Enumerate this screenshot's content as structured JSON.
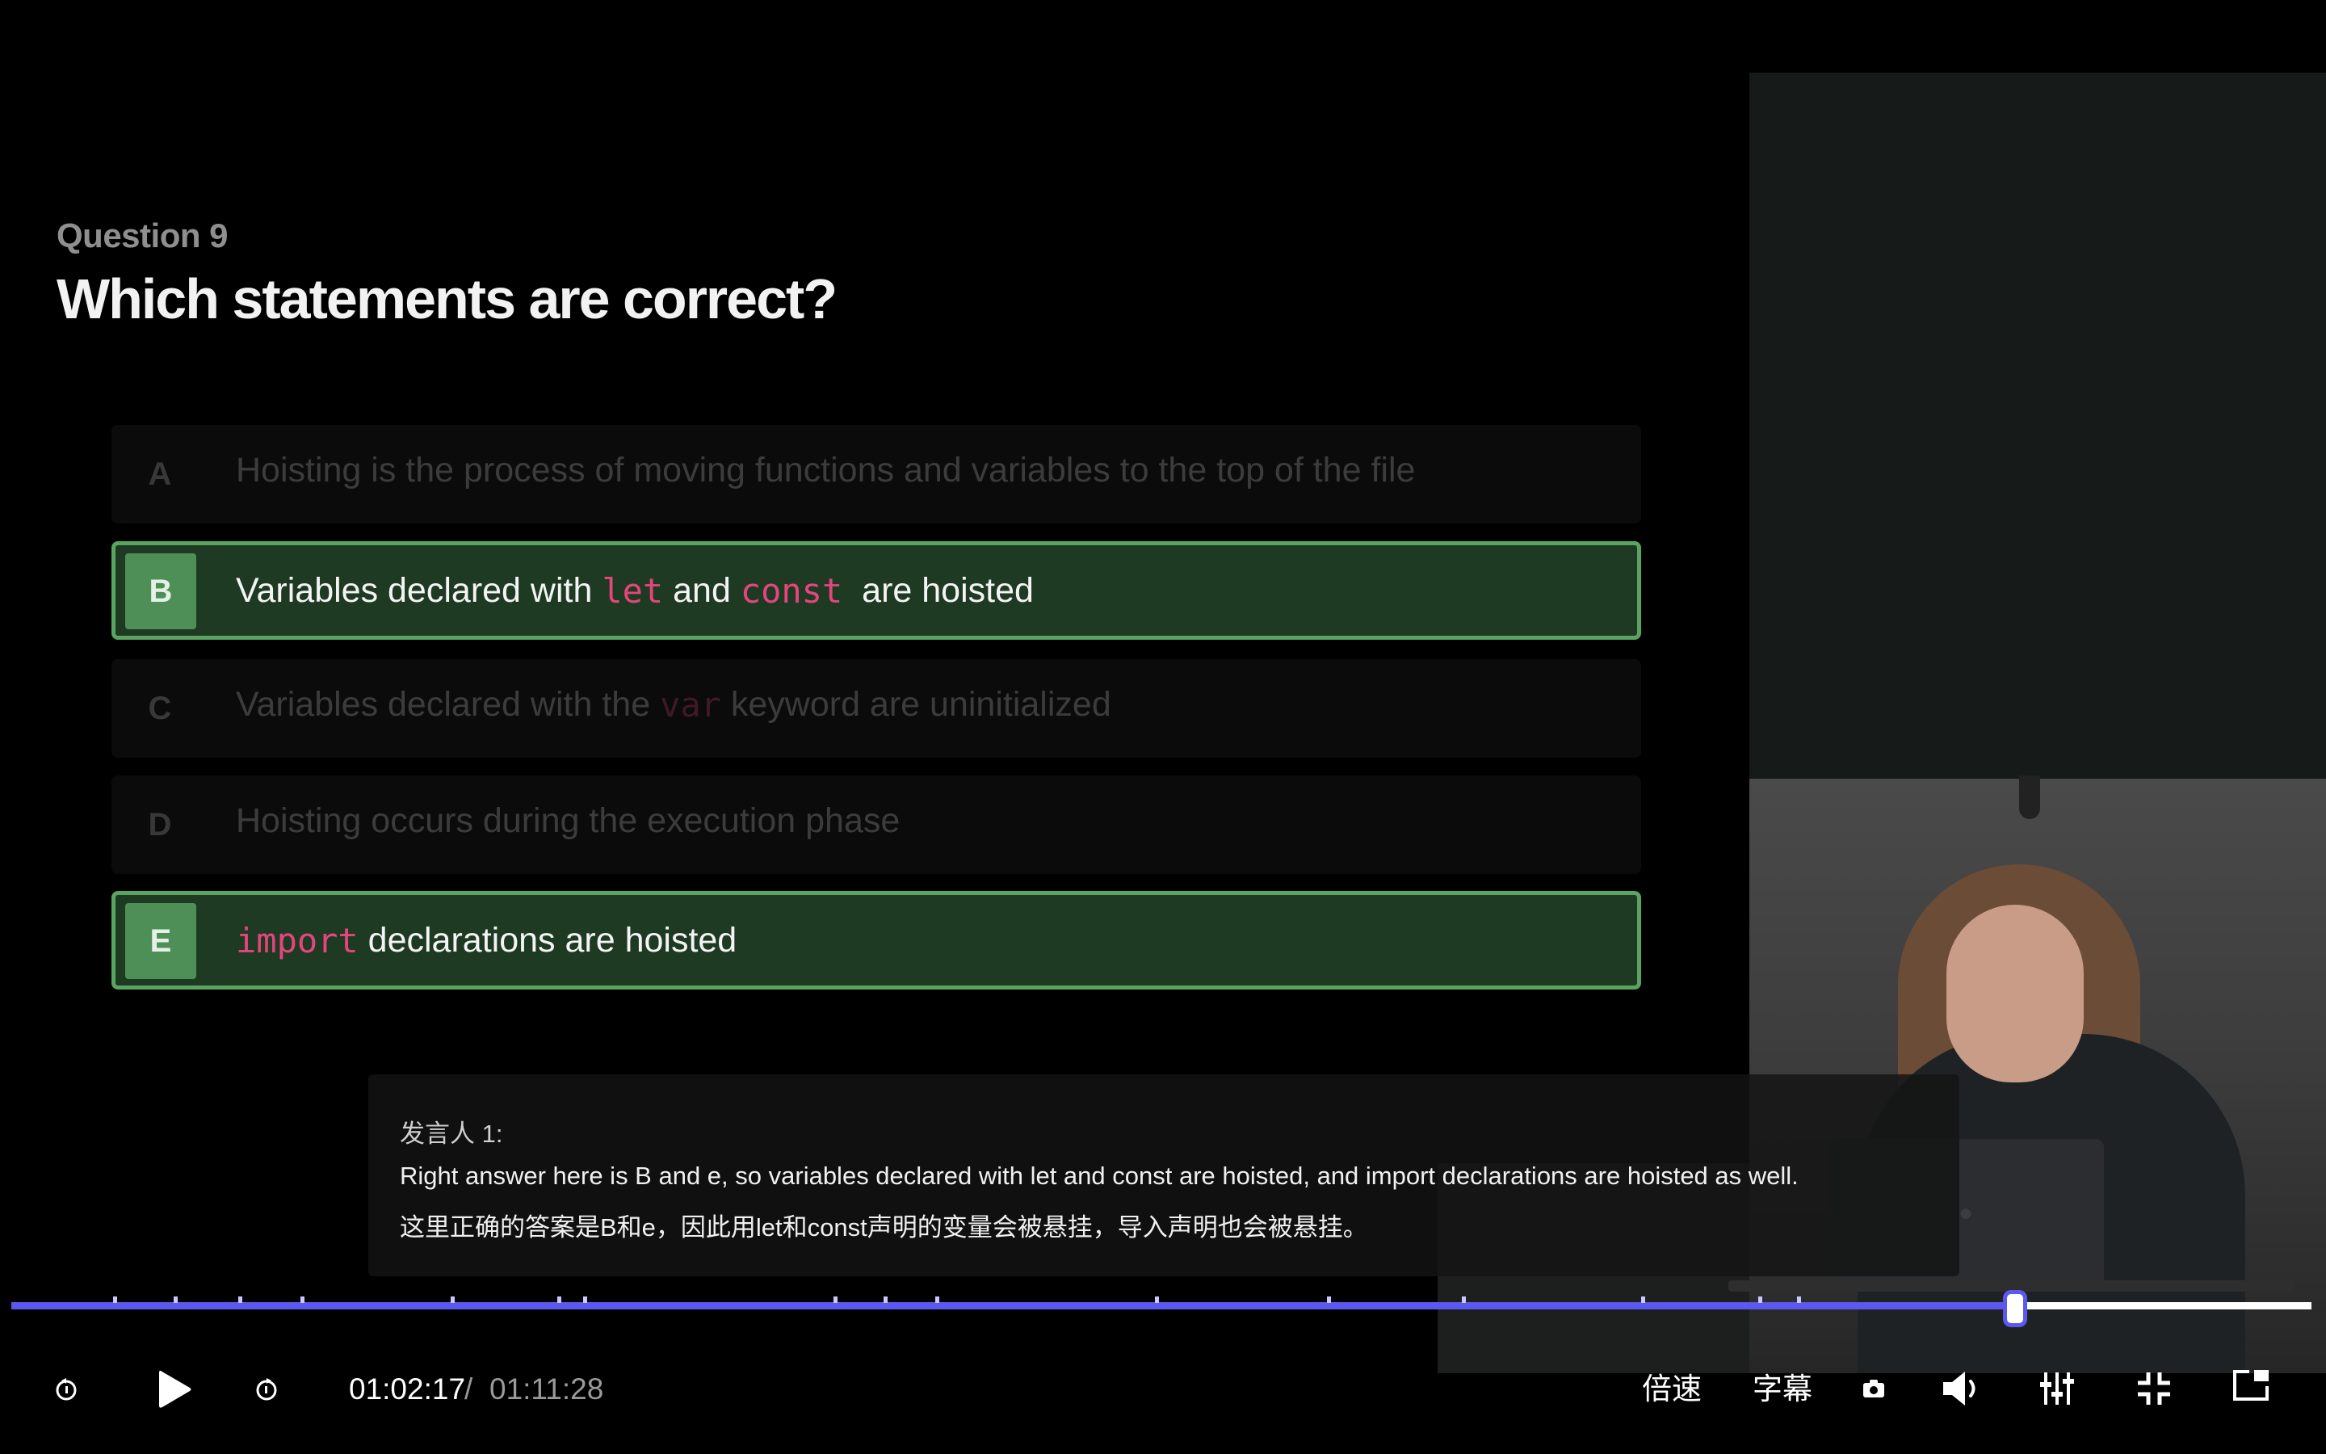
{
  "slide": {
    "question_number": "Question 9",
    "question_title": "Which statements are correct?",
    "options": [
      {
        "letter": "A",
        "before": "Hoisting is the process of moving functions and variables to the top of the file",
        "correct": false
      },
      {
        "letter": "B",
        "before": "Variables declared with ",
        "code1": "let",
        "middle": " and ",
        "code2": "const",
        "after": "  are hoisted",
        "correct": true
      },
      {
        "letter": "C",
        "before": "Variables declared with the ",
        "code1": "var",
        "after": " keyword are uninitialized",
        "correct": false
      },
      {
        "letter": "D",
        "before": "Hoisting occurs during the execution phase",
        "correct": false
      },
      {
        "letter": "E",
        "code1": "import",
        "after": " declarations are hoisted",
        "correct": true
      }
    ]
  },
  "subtitle": {
    "speaker": "发言人 1:",
    "english": "Right answer here is B and e, so variables declared with let and const are hoisted, and import declarations are hoisted as well.",
    "chinese": "这里正确的答案是B和e，因此用let和const声明的变量会被悬挂，导入声明也会被悬挂。"
  },
  "player": {
    "current_time": "01:02:17",
    "separator": "/",
    "total_time": "01:11:28",
    "progress_fraction": 0.871,
    "speed_label": "倍速",
    "subtitle_label": "字幕",
    "accent_color": "#5b58f0",
    "correct_color": "#5aa461",
    "icons": [
      "rewind-icon",
      "play-icon",
      "forward-icon",
      "camera-icon",
      "volume-icon",
      "settings-sliders-icon",
      "exit-fullscreen-icon",
      "picture-in-picture-icon"
    ]
  }
}
